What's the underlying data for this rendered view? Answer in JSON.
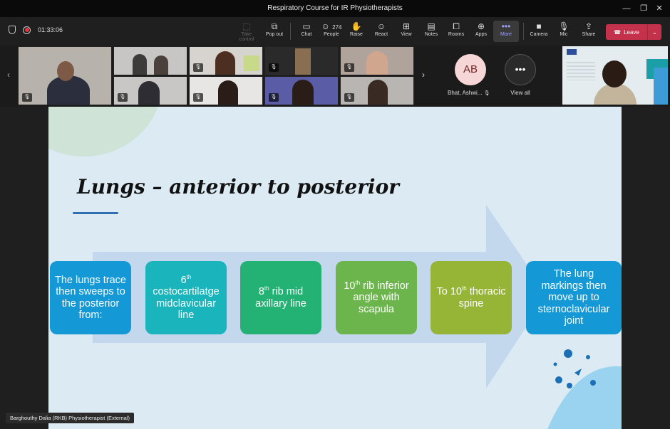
{
  "window": {
    "title": "Respiratory Course for IR Physiotherapists"
  },
  "meeting": {
    "timer": "01:33:06",
    "people_count": "274"
  },
  "toolbar": {
    "take_control": "Take control",
    "pop_out": "Pop out",
    "chat": "Chat",
    "people": "People",
    "raise": "Raise",
    "react": "React",
    "view": "View",
    "notes": "Notes",
    "rooms": "Rooms",
    "apps": "Apps",
    "more": "More",
    "camera": "Camera",
    "mic": "Mic",
    "share": "Share",
    "leave": "Leave"
  },
  "participants": {
    "avatar_initials": "AB",
    "avatar_name": "Bhat, Ashwi...",
    "view_all": "View all"
  },
  "slide": {
    "title": "Lungs – anterior to posterior",
    "boxes": [
      {
        "text": "The lungs trace then sweeps to the posterior from:",
        "color": "#1598d6"
      },
      {
        "pre": "6",
        "sup": "th",
        "post": " costocartilatge midclavicular line",
        "color": "#1ab4bd"
      },
      {
        "pre": "8",
        "sup": "th",
        "post": " rib mid axillary line",
        "color": "#23b274"
      },
      {
        "pre": "10",
        "sup": "th",
        "post": " rib inferior angle with scapula",
        "color": "#6cb44c"
      },
      {
        "pre": "To 10",
        "sup": "th",
        "post": " thoracic spine",
        "color": "#96b436"
      },
      {
        "text": "The lung markings then move up to sternoclavicular joint",
        "color": "#1598d6"
      }
    ]
  },
  "caption": "Barghouthy Dalia (RKB) Physiotherapist (External)",
  "colors": {
    "leave": "#c4314b",
    "accent": "#9fa5ff",
    "slide_bg": "#dcebf3"
  }
}
